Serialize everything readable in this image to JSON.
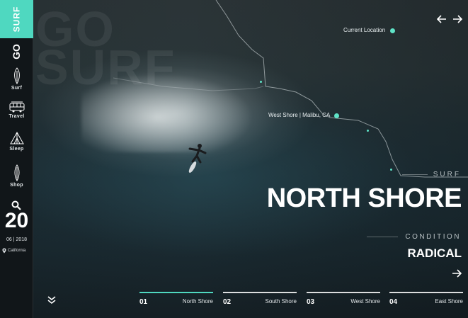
{
  "brand": {
    "name": "SURF",
    "go": "GO"
  },
  "background": {
    "ghost_line1": "GO",
    "ghost_line2": "SURF"
  },
  "sidebar": {
    "items": [
      {
        "label": "Surf",
        "icon": "surfboard-icon"
      },
      {
        "label": "Travel",
        "icon": "van-icon"
      },
      {
        "label": "Sleep",
        "icon": "tent-icon"
      },
      {
        "label": "Shop",
        "icon": "board-icon"
      }
    ],
    "search_icon": "search-icon",
    "day": "20",
    "month_year": "06 | 2018",
    "place": "California"
  },
  "map": {
    "current_location": "Current Location",
    "spot_label": "West Shore | Malibu, CA",
    "accent": "#5fe3c7"
  },
  "hero": {
    "kicker": "SURF",
    "title": "NORTH SHORE",
    "condition_label": "CONDITION",
    "condition_value": "RADICAL"
  },
  "tabs": [
    {
      "num": "01",
      "name": "North Shore",
      "active": true
    },
    {
      "num": "02",
      "name": "South Shore",
      "active": false
    },
    {
      "num": "03",
      "name": "West Shore",
      "active": false
    },
    {
      "num": "04",
      "name": "East Shore",
      "active": false
    }
  ],
  "colors": {
    "accent": "#4fd8c0",
    "sidebar_bg": "#111619"
  }
}
